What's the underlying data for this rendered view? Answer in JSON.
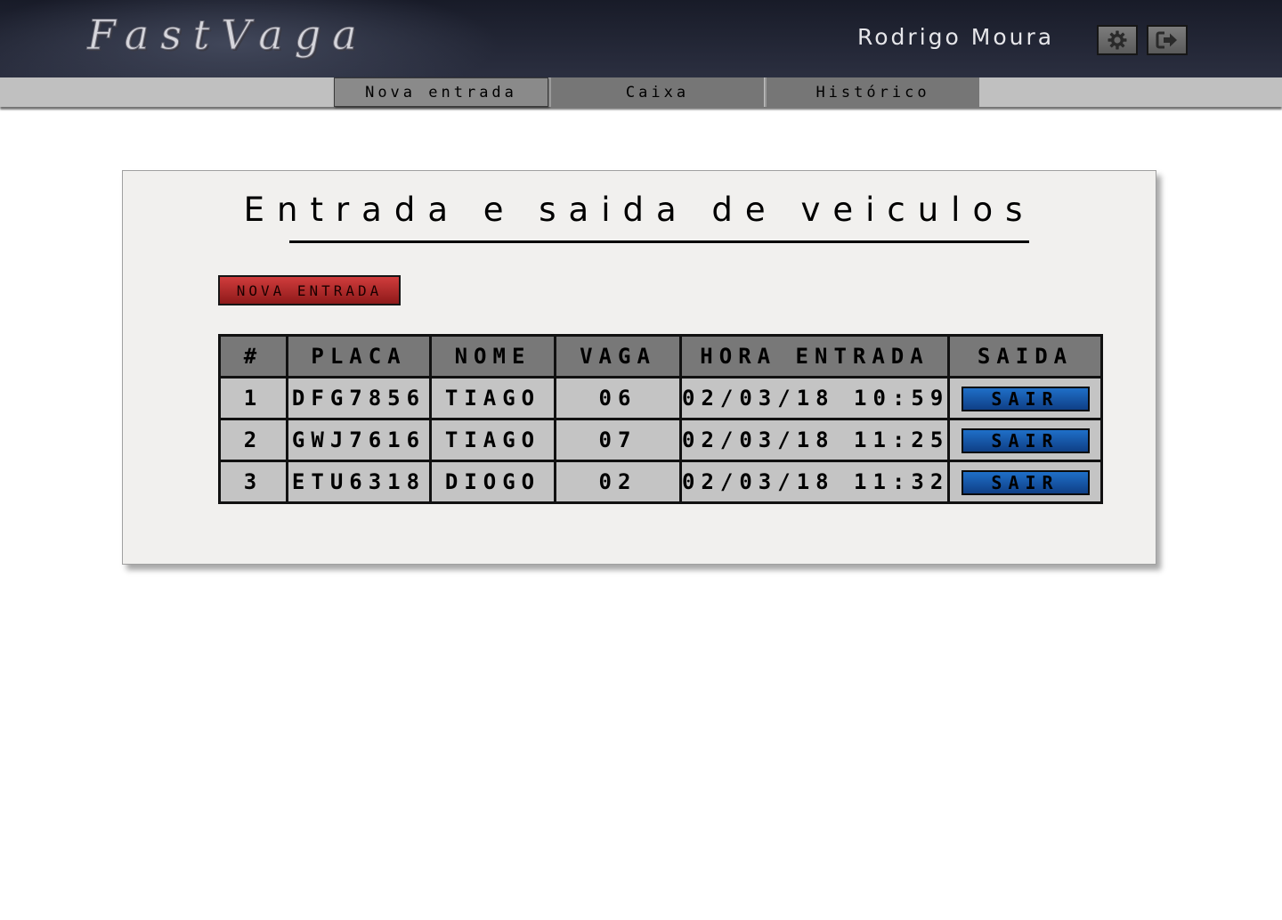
{
  "app": {
    "logo": "FastVaga",
    "username": "Rodrigo Moura",
    "settings_icon": "gear-icon",
    "logout_icon": "logout-icon"
  },
  "nav": {
    "tabs": [
      {
        "label": "Nova entrada",
        "active": true
      },
      {
        "label": "Caixa",
        "active": false
      },
      {
        "label": "Histórico",
        "active": false
      }
    ]
  },
  "main": {
    "title": "Entrada e saida de veiculos",
    "new_entry_button": "NOVA ENTRADA",
    "table": {
      "headers": [
        "#",
        "PLACA",
        "NOME",
        "VAGA",
        "HORA ENTRADA",
        "SAIDA"
      ],
      "rows": [
        {
          "num": "1",
          "placa": "DFG7856",
          "nome": "TIAGO",
          "vaga": "06",
          "hora": "02/03/18 10:59",
          "action": "SAIR"
        },
        {
          "num": "2",
          "placa": "GWJ7616",
          "nome": "TIAGO",
          "vaga": "07",
          "hora": "02/03/18 11:25",
          "action": "SAIR"
        },
        {
          "num": "3",
          "placa": "ETU6318",
          "nome": "DIOGO",
          "vaga": "02",
          "hora": "02/03/18 11:32",
          "action": "SAIR"
        }
      ]
    }
  },
  "colors": {
    "header_bg": "#1c1f2c",
    "nav_bg": "#c0c0c0",
    "tab_bg": "#767676",
    "panel_bg": "#f1f0ee",
    "new_entry_button": "#b02a2a",
    "exit_button": "#1a5cae"
  }
}
